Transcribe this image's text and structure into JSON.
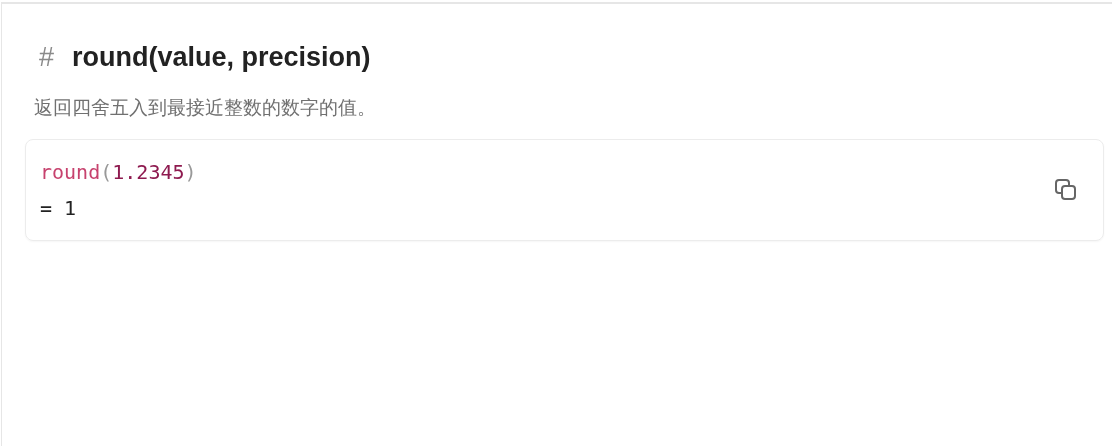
{
  "heading": {
    "anchor": "#",
    "title": "round(value, precision)"
  },
  "description": "返回四舍五入到最接近整数的数字的值。",
  "example": {
    "code": [
      {
        "kind": "function",
        "text": "round"
      },
      {
        "kind": "punct",
        "text": "("
      },
      {
        "kind": "number",
        "text": "1.2345"
      },
      {
        "kind": "punct",
        "text": ")"
      }
    ],
    "result": "= 1"
  }
}
